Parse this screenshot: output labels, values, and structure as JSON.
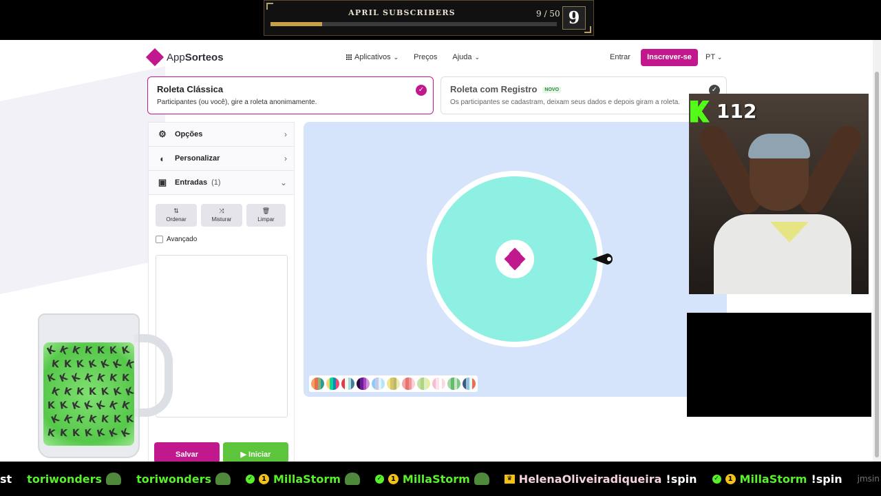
{
  "stream": {
    "sub_goal_title": "APRIL SUBSCRIBERS",
    "sub_goal_count": "9 / 50",
    "sub_goal_current": "9",
    "sub_goal_progress": 0.18,
    "viewer_count": "112"
  },
  "header": {
    "logo_app": "App",
    "logo_name": "Sorteos",
    "nav": [
      "Aplicativos",
      "Preços",
      "Ajuda"
    ],
    "login": "Entrar",
    "signup": "Inscrever-se",
    "lang": "PT"
  },
  "modes": [
    {
      "title": "Roleta Clássica",
      "desc": "Participantes (ou você), gire a roleta anonimamente.",
      "selected": true
    },
    {
      "title": "Roleta com Registro",
      "badge": "NOVO",
      "desc": "Os participantes se cadastram, deixam seus dados e depois giram a roleta.",
      "selected": false
    }
  ],
  "sidebar": {
    "sections": [
      {
        "label": "Opções",
        "icon": "gear-icon"
      },
      {
        "label": "Personalizar",
        "icon": "palette-icon"
      },
      {
        "label": "Entradas",
        "icon": "gift-icon",
        "count": "(1)"
      }
    ],
    "tools": [
      {
        "label": "Ordenar",
        "icon": "sort-icon"
      },
      {
        "label": "Misturar",
        "icon": "shuffle-icon"
      },
      {
        "label": "Limpar",
        "icon": "trash-icon"
      }
    ],
    "advanced_label": "Avançado",
    "save": "Salvar",
    "start": "▶ Iniciar"
  },
  "colors": {
    "brand": "#c2188e",
    "wheel": "#8ef0e3",
    "start": "#5cc53b",
    "wheel_bg": "#d6e4fb"
  },
  "palette": [
    [
      "#f4a261",
      "#e76f51",
      "#8ab17d",
      "#2a9d8f"
    ],
    [
      "#ffd166",
      "#06d6a0",
      "#118ab2",
      "#ef476f"
    ],
    [
      "#e63946",
      "#f1faee",
      "#a8dadc",
      "#457b9d"
    ],
    [
      "#2b0a3d",
      "#6a1b9a",
      "#ab47bc",
      "#ce93d8"
    ],
    [
      "#90caf9",
      "#c5cae9",
      "#e3f2fd",
      "#b3e5fc"
    ],
    [
      "#f0e68c",
      "#d4c56a",
      "#bdb76b",
      "#eee8aa"
    ],
    [
      "#f4a6a6",
      "#e57373",
      "#ef9a9a",
      "#ffcdd2"
    ],
    [
      "#c5e1a5",
      "#aed581",
      "#dcedc8",
      "#e6ee9c"
    ],
    [
      "#f8bbd0",
      "#fce4ec",
      "#ffffff",
      "#fadadd"
    ],
    [
      "#a5d6a7",
      "#66bb6a",
      "#c8e6c9",
      "#81c784"
    ],
    [
      "#3d5a80",
      "#98c1d9",
      "#e0fbfc",
      "#ee6c4d"
    ]
  ],
  "chat": [
    {
      "user": "st",
      "style": "white"
    },
    {
      "user": "toriwonders",
      "emote": "frog-emote"
    },
    {
      "user": "toriwonders",
      "emote": "frog-emote"
    },
    {
      "user": "MillaStorm",
      "badges": [
        "check",
        "coin"
      ],
      "emote": "frog-emote"
    },
    {
      "user": "MillaStorm",
      "badges": [
        "check",
        "coin"
      ],
      "emote": "frog-emote"
    },
    {
      "user": "HelenaOliveiradiqueira",
      "badges": [
        "crown"
      ],
      "cmd": "!spin"
    },
    {
      "user": "MillaStorm",
      "badges": [
        "check",
        "coin"
      ],
      "cmd": "!spin"
    },
    {
      "user": "jmsin",
      "style": "dim"
    }
  ]
}
